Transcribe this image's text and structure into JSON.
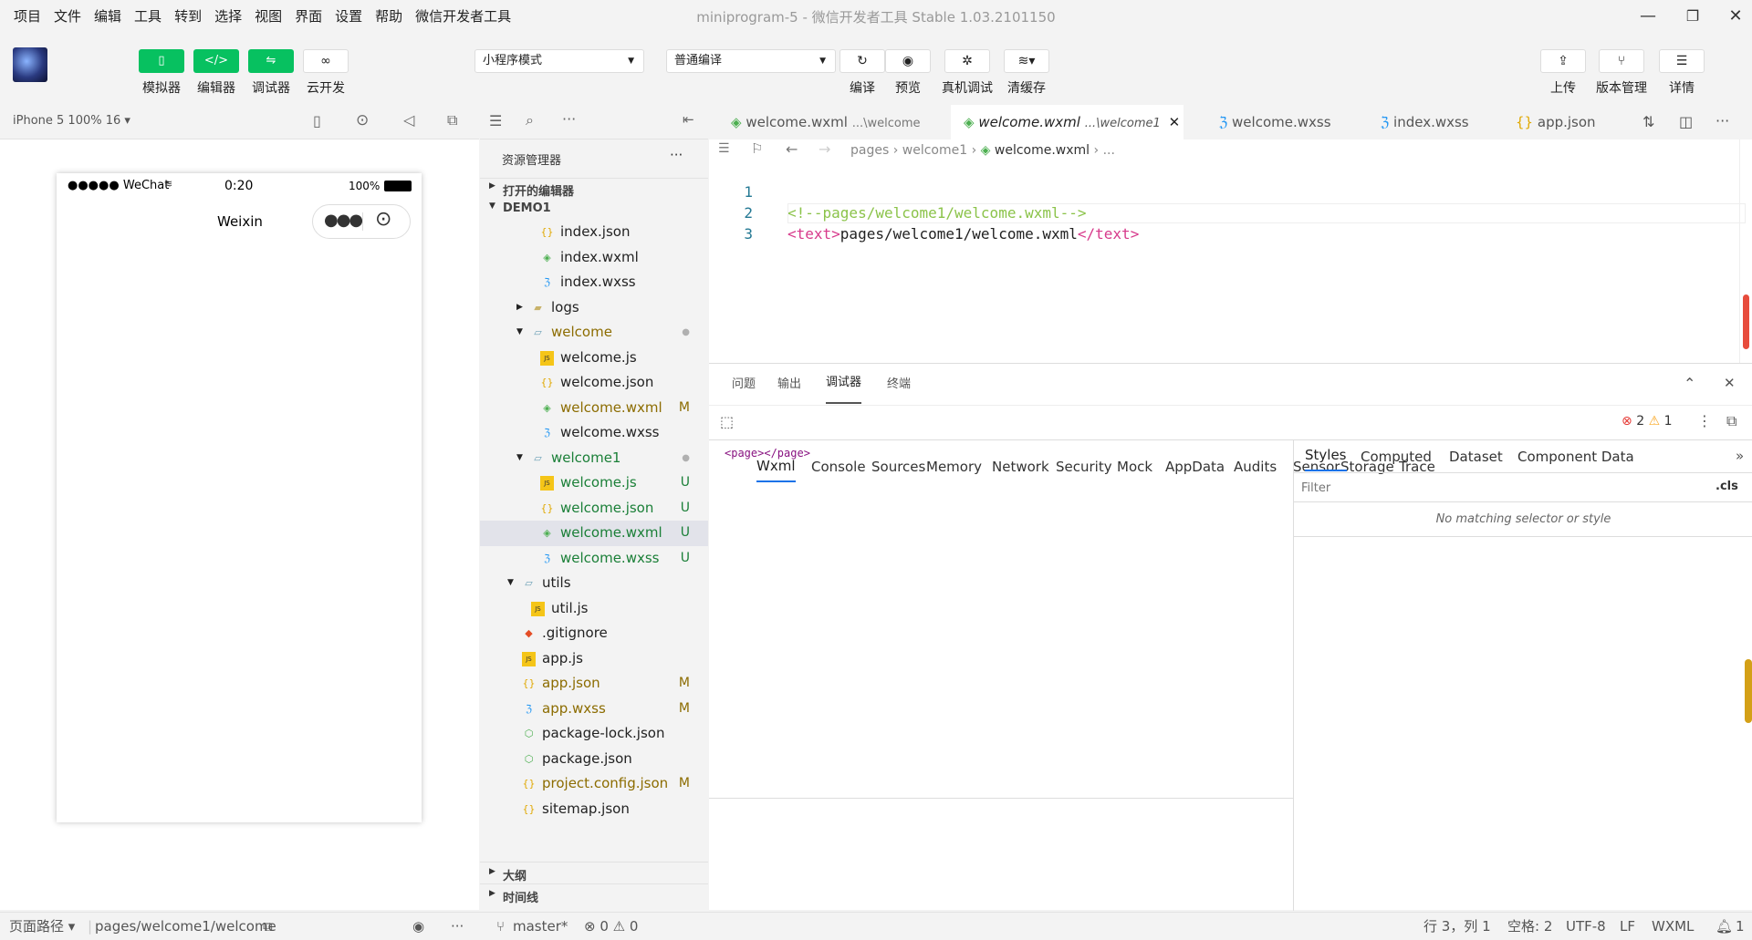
{
  "menu": [
    "项目",
    "文件",
    "编辑",
    "工具",
    "转到",
    "选择",
    "视图",
    "界面",
    "设置",
    "帮助",
    "微信开发者工具"
  ],
  "window_title": "miniprogram-5 - 微信开发者工具 Stable 1.03.2101150",
  "toolbar": {
    "simulator": "模拟器",
    "editor": "编辑器",
    "debugger": "调试器",
    "cloud": "云开发",
    "mode_select": "小程序模式",
    "compile_select": "普通编译",
    "compile": "编译",
    "preview": "预览",
    "real_debug": "真机调试",
    "clear_cache": "清缓存",
    "upload": "上传",
    "version": "版本管理",
    "details": "详情"
  },
  "simulator": {
    "device": "iPhone 5 100% 16 ▾",
    "carrier": "●●●●● WeChat",
    "time": "0:20",
    "battery": "100%",
    "nav_title": "Weixin"
  },
  "explorer": {
    "title": "资源管理器",
    "open_editors": "打开的编辑器",
    "project": "DEMO1",
    "outline": "大纲",
    "timeline": "时间线",
    "rows": [
      {
        "name": "index.json",
        "icon": "json-icon",
        "status": ""
      },
      {
        "name": "index.wxml",
        "icon": "wxml-icon",
        "status": ""
      },
      {
        "name": "index.wxss",
        "icon": "wxss-icon",
        "status": ""
      },
      {
        "name": "logs",
        "icon": "folder-icon",
        "status": ""
      },
      {
        "name": "welcome",
        "icon": "folder-open-icon",
        "status": "●"
      },
      {
        "name": "welcome.js",
        "icon": "js-icon",
        "status": ""
      },
      {
        "name": "welcome.json",
        "icon": "json-icon",
        "status": ""
      },
      {
        "name": "welcome.wxml",
        "icon": "wxml-icon",
        "status": "M"
      },
      {
        "name": "welcome.wxss",
        "icon": "wxss-icon",
        "status": ""
      },
      {
        "name": "welcome1",
        "icon": "folder-open-icon",
        "status": "●"
      },
      {
        "name": "welcome.js",
        "icon": "js-icon",
        "status": "U"
      },
      {
        "name": "welcome.json",
        "icon": "json-icon",
        "status": "U"
      },
      {
        "name": "welcome.wxml",
        "icon": "wxml-icon",
        "status": "U"
      },
      {
        "name": "welcome.wxss",
        "icon": "wxss-icon",
        "status": "U"
      },
      {
        "name": "utils",
        "icon": "folder-open-icon",
        "status": ""
      },
      {
        "name": "util.js",
        "icon": "js-icon",
        "status": ""
      },
      {
        "name": ".gitignore",
        "icon": "git-icon",
        "status": ""
      },
      {
        "name": "app.js",
        "icon": "js-icon",
        "status": ""
      },
      {
        "name": "app.json",
        "icon": "json-icon",
        "status": "M"
      },
      {
        "name": "app.wxss",
        "icon": "wxss-icon",
        "status": "M"
      },
      {
        "name": "package-lock.json",
        "icon": "npm-icon",
        "status": ""
      },
      {
        "name": "package.json",
        "icon": "npm-icon",
        "status": ""
      },
      {
        "name": "project.config.json",
        "icon": "json-icon",
        "status": "M"
      },
      {
        "name": "sitemap.json",
        "icon": "json-icon",
        "status": ""
      }
    ]
  },
  "tabs": [
    {
      "label": "welcome.wxml",
      "hint": "...\\welcome"
    },
    {
      "label": "welcome.wxml",
      "hint": "...\\welcome1"
    },
    {
      "label": "welcome.wxss",
      "hint": ""
    },
    {
      "label": "index.wxss",
      "hint": ""
    },
    {
      "label": "app.json",
      "hint": ""
    }
  ],
  "breadcrumb": {
    "p1": "pages",
    "p2": "welcome1",
    "p3": "welcome.wxml",
    "p4": "..."
  },
  "code": {
    "l1_num": "1",
    "l1": "<!--pages/welcome1/welcome.wxml-->",
    "l2_num": "2",
    "l2_open": "<text>",
    "l2_text": "pages/welcome1/welcome.wxml",
    "l2_close": "</text>",
    "l3_num": "3"
  },
  "devtools": {
    "tabs": [
      "问题",
      "输出",
      "调试器",
      "终端"
    ],
    "panels": [
      "Wxml",
      "Console",
      "Sources",
      "Memory",
      "Network",
      "Security",
      "Mock",
      "AppData",
      "Audits",
      "Sensor",
      "Storage",
      "Trace"
    ],
    "errors": "2",
    "warnings": "1",
    "wxml_tree": "<page></page>",
    "style_tabs": [
      "Styles",
      "Computed",
      "Dataset",
      "Component Data"
    ],
    "filter_placeholder": "Filter",
    "cls": ".cls",
    "no_match": "No matching selector or style"
  },
  "statusbar": {
    "page_path_label": "页面路径 ▾",
    "page_path": "pages/welcome1/welcome",
    "branch": "master*",
    "problems": "⊗ 0 ⚠ 0",
    "position": "行 3，列 1",
    "spaces": "空格: 2",
    "encoding": "UTF-8",
    "eol": "LF",
    "lang": "WXML",
    "notif": "1"
  },
  "colors": {
    "accent": "#07c160",
    "modified": "#8c6c00",
    "untracked": "#1a7f37",
    "tag": "#d73a8b"
  }
}
